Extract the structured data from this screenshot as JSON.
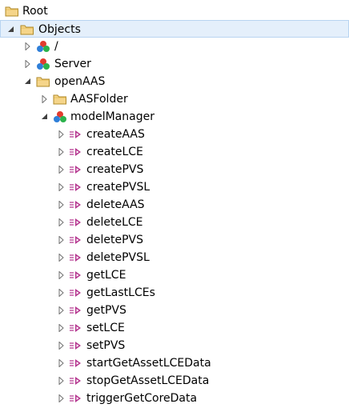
{
  "tree": {
    "root": {
      "label": "Root",
      "icon": "folder-icon"
    },
    "objects": {
      "label": "Objects",
      "icon": "folder-icon",
      "expanded": true,
      "selected": true
    },
    "slash": {
      "label": "/",
      "icon": "object-node-icon"
    },
    "server": {
      "label": "Server",
      "icon": "object-node-icon"
    },
    "openaas": {
      "label": "openAAS",
      "icon": "folder-icon",
      "expanded": true
    },
    "aasfolder": {
      "label": "AASFolder",
      "icon": "folder-icon"
    },
    "modelmanager": {
      "label": "modelManager",
      "icon": "object-node-icon",
      "expanded": true
    },
    "methods": [
      {
        "label": "createAAS",
        "icon": "method-icon"
      },
      {
        "label": "createLCE",
        "icon": "method-icon"
      },
      {
        "label": "createPVS",
        "icon": "method-icon"
      },
      {
        "label": "createPVSL",
        "icon": "method-icon"
      },
      {
        "label": "deleteAAS",
        "icon": "method-icon"
      },
      {
        "label": "deleteLCE",
        "icon": "method-icon"
      },
      {
        "label": "deletePVS",
        "icon": "method-icon"
      },
      {
        "label": "deletePVSL",
        "icon": "method-icon"
      },
      {
        "label": "getLCE",
        "icon": "method-icon"
      },
      {
        "label": "getLastLCEs",
        "icon": "method-icon"
      },
      {
        "label": "getPVS",
        "icon": "method-icon"
      },
      {
        "label": "setLCE",
        "icon": "method-icon"
      },
      {
        "label": "setPVS",
        "icon": "method-icon"
      },
      {
        "label": "startGetAssetLCEData",
        "icon": "method-icon"
      },
      {
        "label": "stopGetAssetLCEData",
        "icon": "method-icon"
      },
      {
        "label": "triggerGetCoreData",
        "icon": "method-icon"
      }
    ]
  },
  "colors": {
    "selection_bg": "#e4effb",
    "selection_border": "#b8d4f1",
    "folder_fill": "#f5d58a",
    "folder_stroke": "#b08a2a",
    "method_color": "#b5368f"
  }
}
